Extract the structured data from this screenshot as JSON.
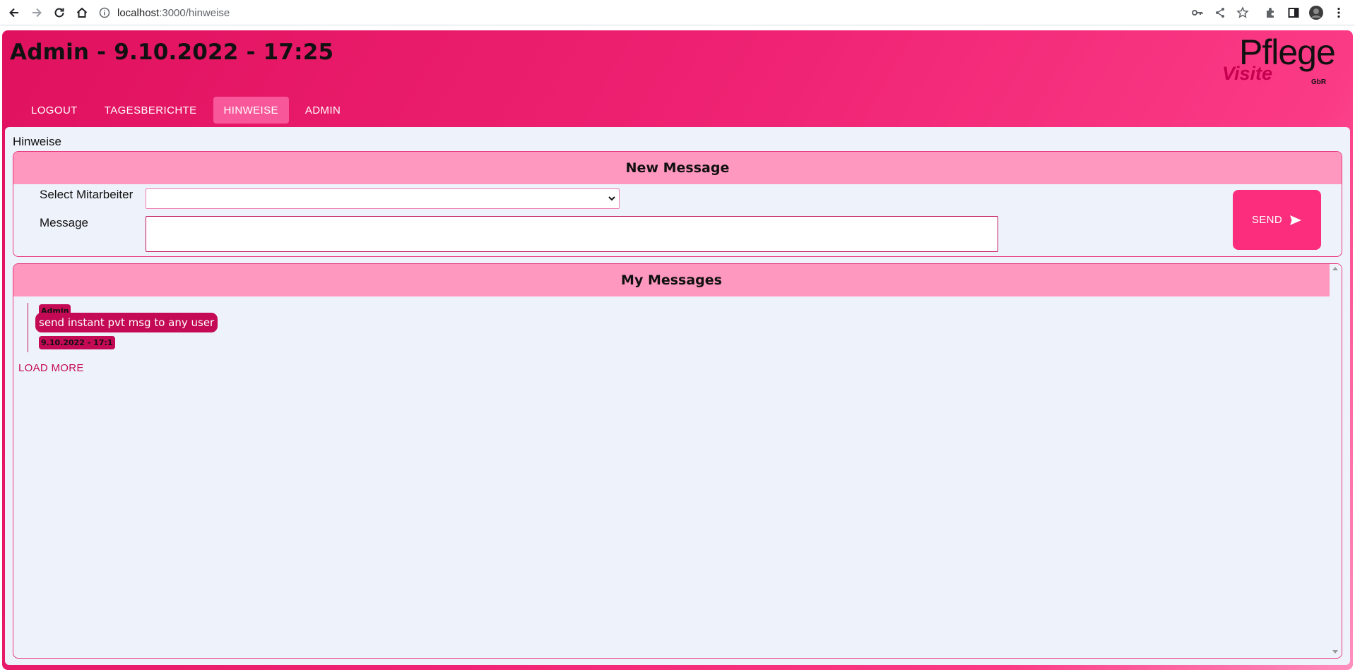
{
  "browser": {
    "url_host": "localhost",
    "url_path": ":3000/hinweise"
  },
  "app": {
    "title": "Admin - 9.10.2022 - 17:25",
    "logo": {
      "top": "Pflege",
      "bottom": "Visite",
      "suffix": "GbR"
    }
  },
  "nav": {
    "items": [
      {
        "label": "LOGOUT",
        "active": false
      },
      {
        "label": "TAGESBERICHTE",
        "active": false
      },
      {
        "label": "HINWEISE",
        "active": true
      },
      {
        "label": "ADMIN",
        "active": false
      }
    ]
  },
  "page": {
    "label": "Hinweise"
  },
  "new_message": {
    "title": "New Message",
    "select_label": "Select Mitarbeiter",
    "select_value": "",
    "message_label": "Message",
    "message_value": "",
    "send_label": "SEND",
    "send_icon": "send-icon"
  },
  "my_messages": {
    "title": "My Messages",
    "messages": [
      {
        "author": "Admin",
        "text": "send instant pvt msg to any user",
        "time": "9.10.2022 - 17:1"
      }
    ],
    "load_more_label": "LOAD MORE"
  },
  "colors": {
    "brand_pink": "#ef2273",
    "header_pink": "#ff98bf",
    "message_bubble": "#c40a55",
    "send_button": "#fc2d7c",
    "content_bg": "#eef3fb"
  }
}
